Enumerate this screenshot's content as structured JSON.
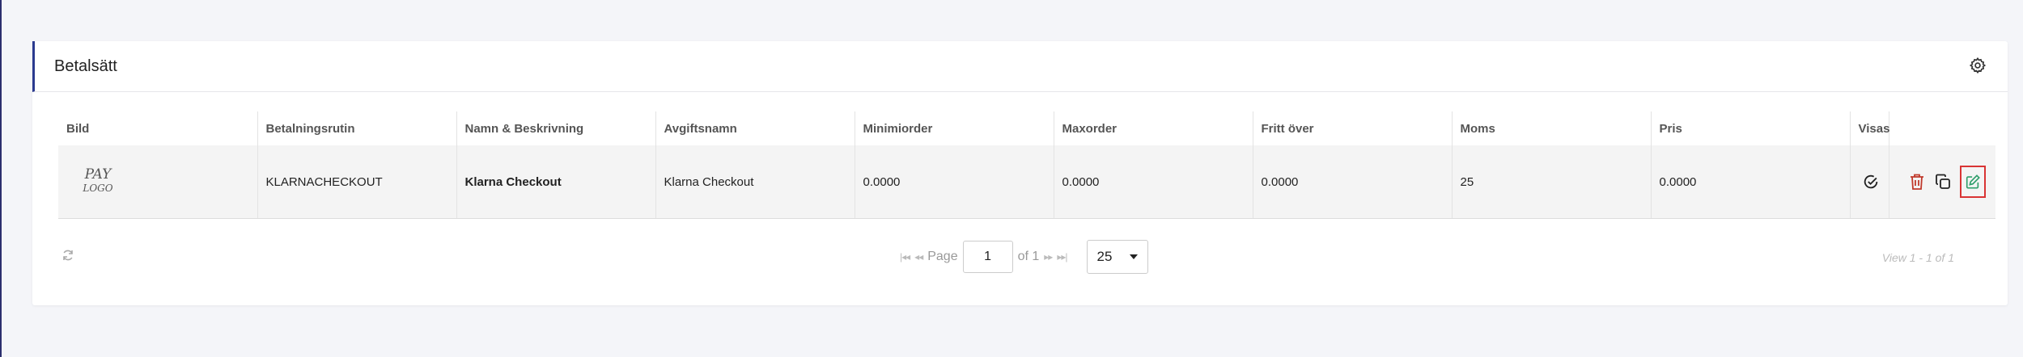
{
  "panel": {
    "title": "Betalsätt"
  },
  "table": {
    "headers": [
      "Bild",
      "Betalningsrutin",
      "Namn & Beskrivning",
      "Avgiftsnamn",
      "Minimiorder",
      "Maxorder",
      "Fritt över",
      "Moms",
      "Pris",
      "Visas",
      ""
    ],
    "rows": [
      {
        "logo_line1": "PAY",
        "logo_line2": "LOGO",
        "rutin": "KLARNACHECKOUT",
        "namn": "Klarna Checkout",
        "avgiftsnamn": "Klarna Checkout",
        "minimiorder": "0.0000",
        "maxorder": "0.0000",
        "fritt_over": "0.0000",
        "moms": "25",
        "pris": "0.0000",
        "visas_icon": "check-circle-icon"
      }
    ]
  },
  "pager": {
    "page_label": "Page",
    "current_page": "1",
    "of_label": "of 1",
    "page_size": "25",
    "view_info": "View 1 - 1 of 1"
  },
  "colors": {
    "accent": "#2b3a8f",
    "delete": "#c0392b",
    "edit": "#2e9e6a",
    "highlight": "#d93434"
  }
}
